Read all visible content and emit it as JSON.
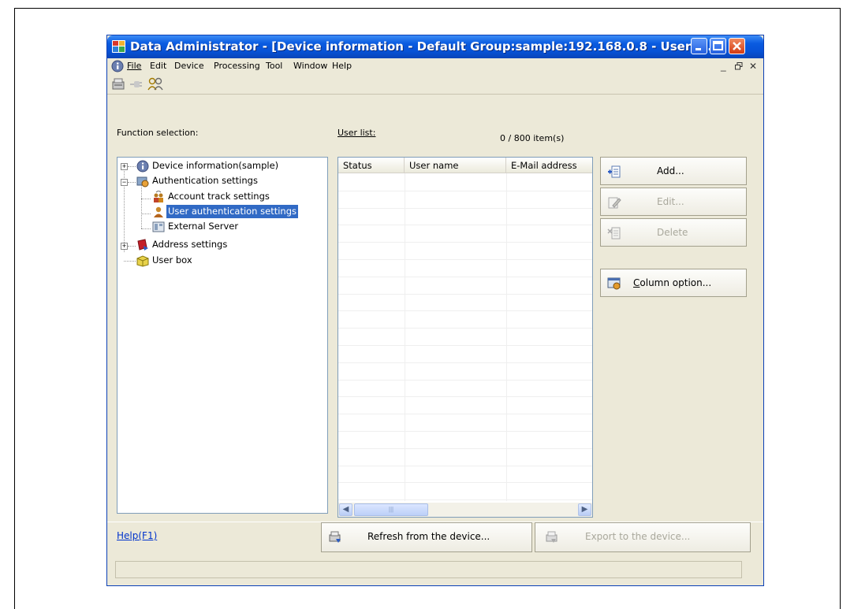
{
  "window": {
    "title": "Data Administrator - [Device information - Default Group:sample:192.168.0.8 - User a..."
  },
  "menu": {
    "items": [
      "File",
      "Edit",
      "Device",
      "Processing",
      "Tool",
      "Window",
      "Help"
    ],
    "mdi_controls": [
      "_",
      "̅",
      "×"
    ]
  },
  "left_panel": {
    "label": "Function selection:",
    "tree": [
      {
        "label": "Device information(sample)",
        "icon": "info-icon",
        "expander": "+"
      },
      {
        "label": "Authentication settings",
        "icon": "auth-settings-icon",
        "expander": "-"
      },
      {
        "label": "Account track settings",
        "icon": "account-track-icon"
      },
      {
        "label": "User authentication settings",
        "icon": "user-icon",
        "selected": true
      },
      {
        "label": "External Server",
        "icon": "server-icon"
      },
      {
        "label": "Address settings",
        "icon": "address-book-icon",
        "expander": "+"
      },
      {
        "label": "User box",
        "icon": "box-icon"
      }
    ]
  },
  "user_list": {
    "label": "User list:",
    "count": "0 / 800 item(s)",
    "columns": [
      "Status",
      "User name",
      "E-Mail address"
    ]
  },
  "buttons": {
    "add": "Add...",
    "edit": "Edit...",
    "delete": "Delete",
    "column_option": "Column option...",
    "refresh": "Refresh from the device...",
    "export": "Export to the device..."
  },
  "footer": {
    "help": "Help(F1)"
  },
  "colors": {
    "titlebar": "#0752d6",
    "selection": "#316ac5",
    "window_bg": "#ece9d8",
    "link": "#0033cc"
  }
}
